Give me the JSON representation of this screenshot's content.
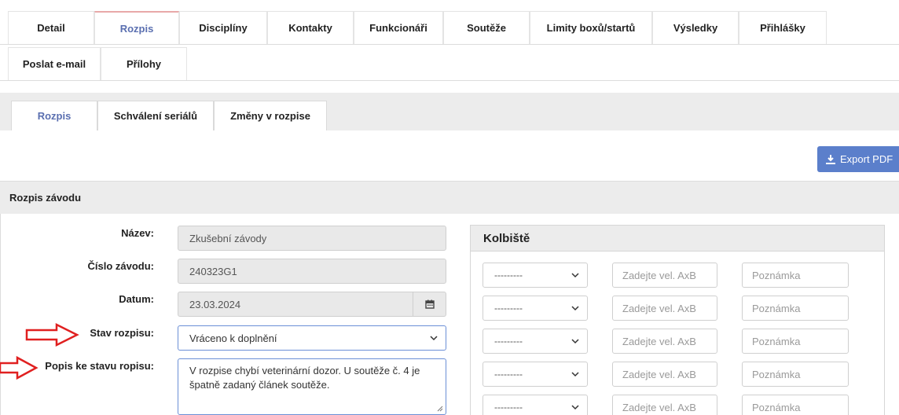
{
  "tabs_row1": [
    "Detail",
    "Rozpis",
    "Disciplíny",
    "Kontakty",
    "Funkcionáři",
    "Soutěže",
    "Limity boxů/startů",
    "Výsledky",
    "Přihlášky"
  ],
  "tabs_row2": [
    "Poslat e-mail",
    "Přílohy"
  ],
  "active_tab": "Rozpis",
  "subtabs": [
    "Rozpis",
    "Schválení seriálů",
    "Změny v rozpise"
  ],
  "export_label": "Export PDF",
  "panel_title": "Rozpis závodu",
  "form": {
    "nazev_label": "Název:",
    "nazev_value": "Zkušební závody",
    "cislo_label": "Číslo závodu:",
    "cislo_value": "240323G1",
    "datum_label": "Datum:",
    "datum_value": "23.03.2024",
    "stav_label": "Stav rozpisu:",
    "stav_value": "Vráceno k doplnění",
    "popis_label": "Popis ke stavu ropisu:",
    "popis_value": "V rozpise chybí veterinární dozor. U soutěže č. 4 je špatně zadaný článek soutěže."
  },
  "kolbiste": {
    "title": "Kolbiště",
    "rows": [
      {
        "select": "---------",
        "size_placeholder": "Zadejte vel. AxB",
        "note_placeholder": "Poznámka"
      },
      {
        "select": "---------",
        "size_placeholder": "Zadejte vel. AxB",
        "note_placeholder": "Poznámka"
      },
      {
        "select": "---------",
        "size_placeholder": "Zadejte vel. AxB",
        "note_placeholder": "Poznámka"
      },
      {
        "select": "---------",
        "size_placeholder": "Zadejte vel. AxB",
        "note_placeholder": "Poznámka"
      },
      {
        "select": "---------",
        "size_placeholder": "Zadejte vel. AxB",
        "note_placeholder": "Poznámka"
      }
    ]
  },
  "colors": {
    "accent": "#5a6fb0",
    "export_button": "#5b7fcb",
    "arrow": "#e02020"
  }
}
